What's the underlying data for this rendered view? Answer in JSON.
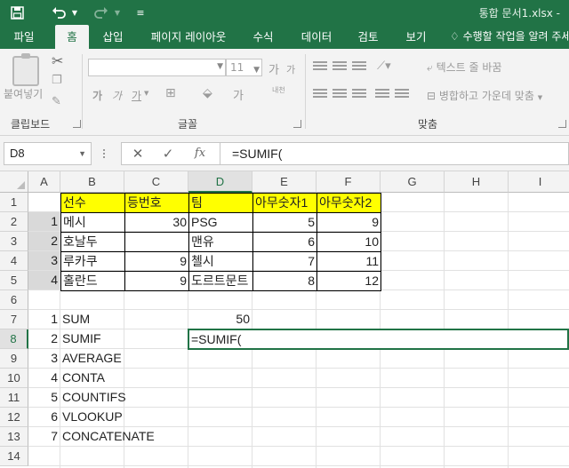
{
  "window": {
    "title": "통합 문서1.xlsx -"
  },
  "quick_access": {
    "save": "save-icon",
    "undo": "undo-icon",
    "redo": "redo-icon",
    "customize": "customize-icon"
  },
  "tabs": [
    "파일",
    "홈",
    "삽입",
    "페이지 레이아웃",
    "수식",
    "데이터",
    "검토",
    "보기"
  ],
  "active_tab": "홈",
  "tell_me": "수행할 작업을 알려 주세요",
  "ribbon": {
    "clipboard": {
      "paste": "붙여넣기",
      "group": "클립보드"
    },
    "font": {
      "name": "",
      "size": "11",
      "grow": "가",
      "shrink": "가",
      "bold": "가",
      "italic": "가",
      "underline": "가",
      "phonetic": "내천",
      "font_color": "가",
      "group": "글꼴"
    },
    "alignment": {
      "wrap_text": "텍스트 줄 바꿈",
      "merge_center": "병합하고 가운데 맞춤",
      "group": "맞춤"
    }
  },
  "formula_bar": {
    "name_box": "D8",
    "cancel": "✕",
    "enter": "✓",
    "fx": "fx",
    "content": "=SUMIF("
  },
  "columns": [
    "A",
    "B",
    "C",
    "D",
    "E",
    "F",
    "G",
    "H",
    "I"
  ],
  "selected_column": "D",
  "selected_row": "8",
  "rows": [
    "1",
    "2",
    "3",
    "4",
    "5",
    "6",
    "7",
    "8",
    "9",
    "10",
    "11",
    "12",
    "13",
    "14"
  ],
  "table": {
    "headers": [
      "선수",
      "등번호",
      "팀",
      "아무숫자1",
      "아무숫자2"
    ],
    "rows": [
      {
        "a": "1",
        "player": "메시",
        "number": "30",
        "team": "PSG",
        "n1": "5",
        "n2": "9"
      },
      {
        "a": "2",
        "player": "호날두",
        "number": "",
        "team": "맨유",
        "n1": "6",
        "n2": "10"
      },
      {
        "a": "3",
        "player": "루카쿠",
        "number": "9",
        "team": "첼시",
        "n1": "7",
        "n2": "11"
      },
      {
        "a": "4",
        "player": "홀란드",
        "number": "9",
        "team": "도르트문트",
        "n1": "8",
        "n2": "12"
      }
    ]
  },
  "functions": [
    {
      "idx": "1",
      "name": "SUM",
      "value": "50"
    },
    {
      "idx": "2",
      "name": "SUMIF",
      "value": "=SUMIF("
    },
    {
      "idx": "3",
      "name": "AVERAGE",
      "value": ""
    },
    {
      "idx": "4",
      "name": "CONTA",
      "value": ""
    },
    {
      "idx": "5",
      "name": "COUNTIFS",
      "value": ""
    },
    {
      "idx": "6",
      "name": "VLOOKUP",
      "value": ""
    },
    {
      "idx": "7",
      "name": "CONCATENATE",
      "value": ""
    }
  ],
  "colors": {
    "excel_green": "#217346",
    "header_fill": "#ffff00",
    "grey_fill": "#d9d9d9"
  }
}
